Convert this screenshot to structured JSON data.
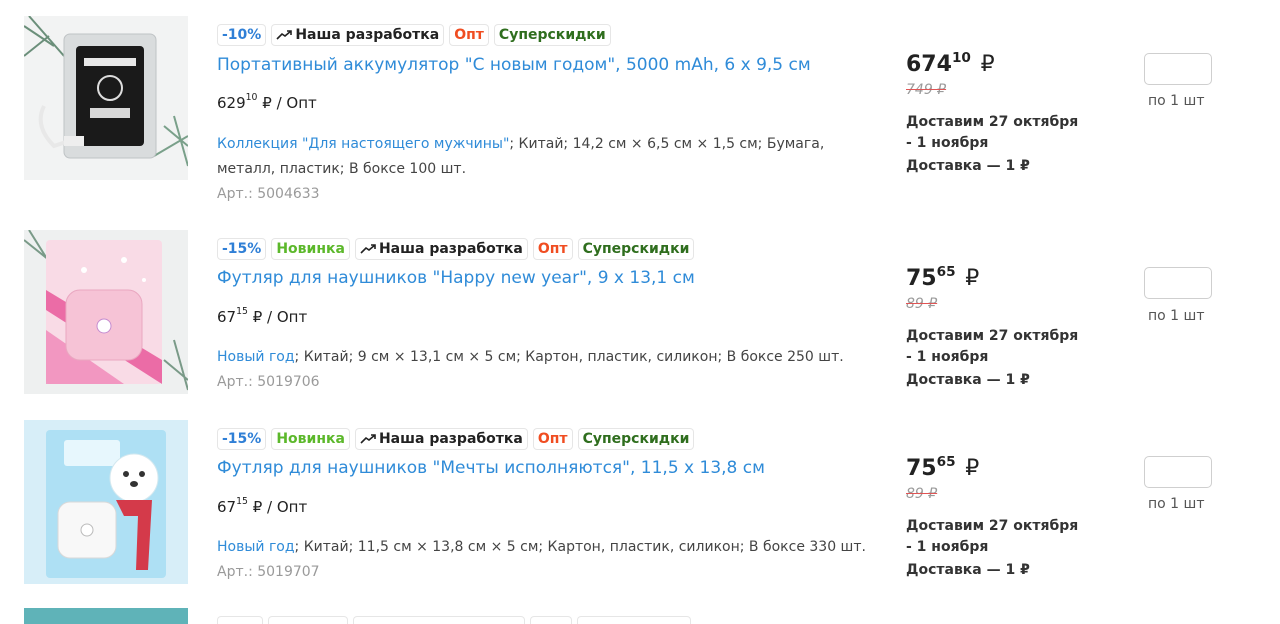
{
  "products": [
    {
      "badges": {
        "discount": "-10%",
        "dev": "Наша разработка",
        "opt": "Опт",
        "super": "Суперскидки"
      },
      "title": "Портативный аккумулятор \"С новым годом\", 5000 mAh, 6 x 9,5 см",
      "wholesale_int": "629",
      "wholesale_frac": "10",
      "wholesale_suffix": "₽ / Опт",
      "collection": "Коллекция \"Для настоящего мужчины\"",
      "desc_line1": "; Китай; 14,2 см × 6,5 см × 1,5 см; Бумага,",
      "desc_line2": "металл, пластик; В боксе 100 шт.",
      "article": "Арт.: 5004633",
      "price_int": "674",
      "price_frac": "10",
      "currency": "₽",
      "old_price": "749 ₽",
      "delivery": "Доставим 27 октября - 1 ноября",
      "delivery_cost": "Доставка — 1 ₽",
      "qty_unit": "по 1 шт"
    },
    {
      "badges": {
        "discount": "-15%",
        "new": "Новинка",
        "dev": "Наша разработка",
        "opt": "Опт",
        "super": "Суперскидки"
      },
      "title": "Футляр для наушников \"Happy new year\", 9 x 13,1 см",
      "wholesale_int": "67",
      "wholesale_frac": "15",
      "wholesale_suffix": "₽ / Опт",
      "collection": "Новый год",
      "desc_line1": "; Китай; 9 см × 13,1 см × 5 см; Картон, пластик, силикон; В боксе 250 шт.",
      "article": "Арт.: 5019706",
      "price_int": "75",
      "price_frac": "65",
      "currency": "₽",
      "old_price": "89 ₽",
      "delivery": "Доставим 27 октября - 1 ноября",
      "delivery_cost": "Доставка — 1 ₽",
      "qty_unit": "по 1 шт"
    },
    {
      "badges": {
        "discount": "-15%",
        "new": "Новинка",
        "dev": "Наша разработка",
        "opt": "Опт",
        "super": "Суперскидки"
      },
      "title": "Футляр для наушников \"Мечты исполняются\", 11,5 x 13,8 см",
      "wholesale_int": "67",
      "wholesale_frac": "15",
      "wholesale_suffix": "₽ / Опт",
      "collection": "Новый год",
      "desc_line1": "; Китай; 11,5 см × 13,8 см × 5 см; Картон, пластик, силикон; В боксе 330 шт.",
      "article": "Арт.: 5019707",
      "price_int": "75",
      "price_frac": "65",
      "currency": "₽",
      "old_price": "89 ₽",
      "delivery": "Доставим 27 октября - 1 ноября",
      "delivery_cost": "Доставка — 1 ₽",
      "qty_unit": "по 1 шт"
    }
  ],
  "icons": {
    "dev_icon": "handshake-arrow-icon"
  },
  "colors": {
    "link": "#2f8bd8",
    "new_badge": "#5cb82b",
    "opt_badge": "#f04d21",
    "super_badge": "#2f6e1e",
    "discount_badge": "#2f7fd6"
  }
}
